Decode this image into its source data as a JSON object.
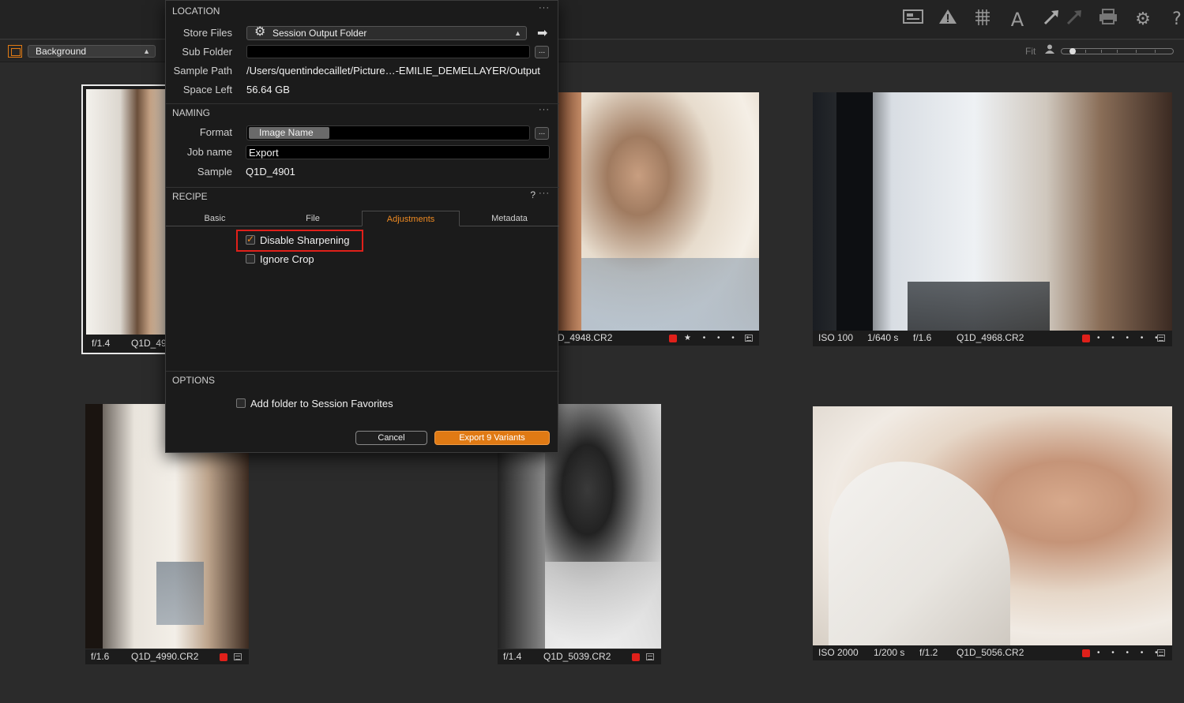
{
  "toolbar": {
    "icons": [
      "layout-icon",
      "warning-icon",
      "grid-icon",
      "text-annotation-icon",
      "picker-arrow-icon",
      "picker-arrow-dim-icon",
      "print-icon",
      "gear-icon",
      "help-icon"
    ],
    "glyphs": [
      "▦",
      "⚠",
      "▩",
      "A",
      "➚",
      "➚",
      "⎙",
      "⚙",
      "?"
    ]
  },
  "viewer_bar": {
    "background_label": "Background",
    "fit_label": "Fit"
  },
  "dialog": {
    "location": {
      "title": "LOCATION",
      "store_files_label": "Store Files",
      "store_files_value": "Session Output Folder",
      "sub_folder_label": "Sub Folder",
      "sub_folder_value": "",
      "sample_path_label": "Sample Path",
      "sample_path_value": "/Users/quentindecaillet/Picture…-EMILIE_DEMELLAYER/Output",
      "space_left_label": "Space Left",
      "space_left_value": "56.64 GB"
    },
    "naming": {
      "title": "NAMING",
      "format_label": "Format",
      "format_token": "Image Name",
      "job_name_label": "Job name",
      "job_name_value": "Export",
      "sample_label": "Sample",
      "sample_value": "Q1D_4901"
    },
    "recipe": {
      "title": "RECIPE",
      "help": "?",
      "tabs": [
        "Basic",
        "File",
        "Adjustments",
        "Metadata"
      ],
      "active_tab": "Adjustments",
      "options": [
        {
          "label": "Disable Sharpening",
          "checked": true
        },
        {
          "label": "Ignore Crop",
          "checked": false
        }
      ]
    },
    "options": {
      "title": "OPTIONS",
      "add_folder_label": "Add folder to Session Favorites",
      "add_folder_checked": false
    },
    "more": "···",
    "ellipsis": "...",
    "cancel_label": "Cancel",
    "export_label": "Export 9 Variants"
  },
  "thumbnails": [
    {
      "aperture": "f/1.4",
      "filename": "Q1D_49"
    },
    {
      "filename": "D_4948.CR2",
      "rating": "★ • • • •"
    },
    {
      "iso": "ISO 100",
      "shutter": "1/640 s",
      "aperture": "f/1.6",
      "filename": "Q1D_4968.CR2",
      "rating": "• • • • •"
    },
    {
      "aperture": "f/1.6",
      "filename": "Q1D_4990.CR2"
    },
    {
      "aperture": "f/1.4",
      "filename": "Q1D_5039.CR2"
    },
    {
      "iso": "ISO 2000",
      "shutter": "1/200 s",
      "aperture": "f/1.2",
      "filename": "Q1D_5056.CR2",
      "rating": "• • • • •"
    }
  ],
  "colors": {
    "accent": "#e07a14",
    "color_tag_red": "#e0201a",
    "highlight_box": "#e0201a"
  }
}
